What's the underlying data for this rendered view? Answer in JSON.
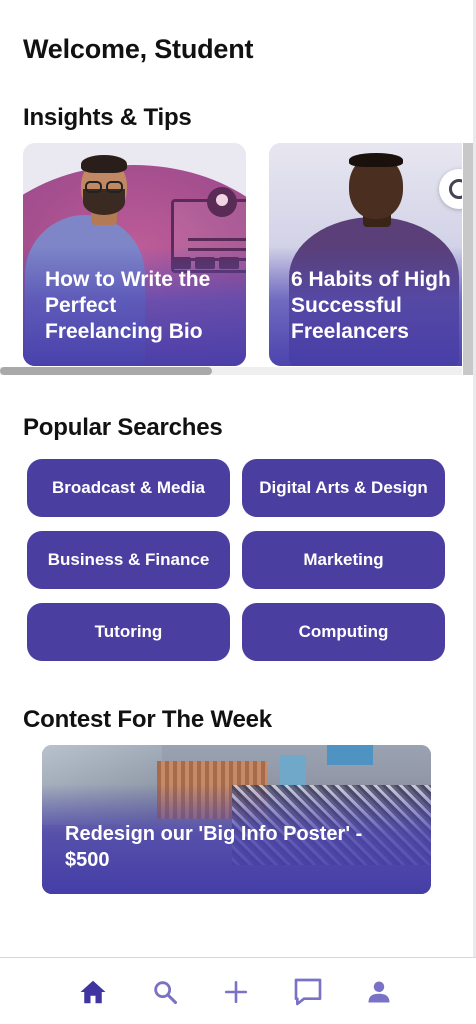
{
  "header": {
    "welcome": "Welcome, Student"
  },
  "insights": {
    "title": "Insights & Tips",
    "cards": [
      {
        "title": "How to Write the Perfect Freelancing Bio"
      },
      {
        "title": "6 Habits of High Successful Freelancers"
      }
    ]
  },
  "popular": {
    "title": "Popular Searches",
    "items": [
      "Broadcast & Media",
      "Digital Arts & Design",
      "Business & Finance",
      "Marketing",
      "Tutoring",
      "Computing"
    ]
  },
  "contest": {
    "title": "Contest For The Week",
    "card_title": "Redesign our 'Big Info Poster' - $500"
  },
  "bottom_nav": {
    "items": [
      {
        "icon": "home-icon",
        "active": true
      },
      {
        "icon": "search-icon",
        "active": false
      },
      {
        "icon": "plus-icon",
        "active": false
      },
      {
        "icon": "chat-icon",
        "active": false
      },
      {
        "icon": "profile-icon",
        "active": false
      }
    ]
  },
  "colors": {
    "accent": "#4a3fa0",
    "nav_active": "#3f34a0",
    "nav_inactive": "#7a72c4"
  }
}
